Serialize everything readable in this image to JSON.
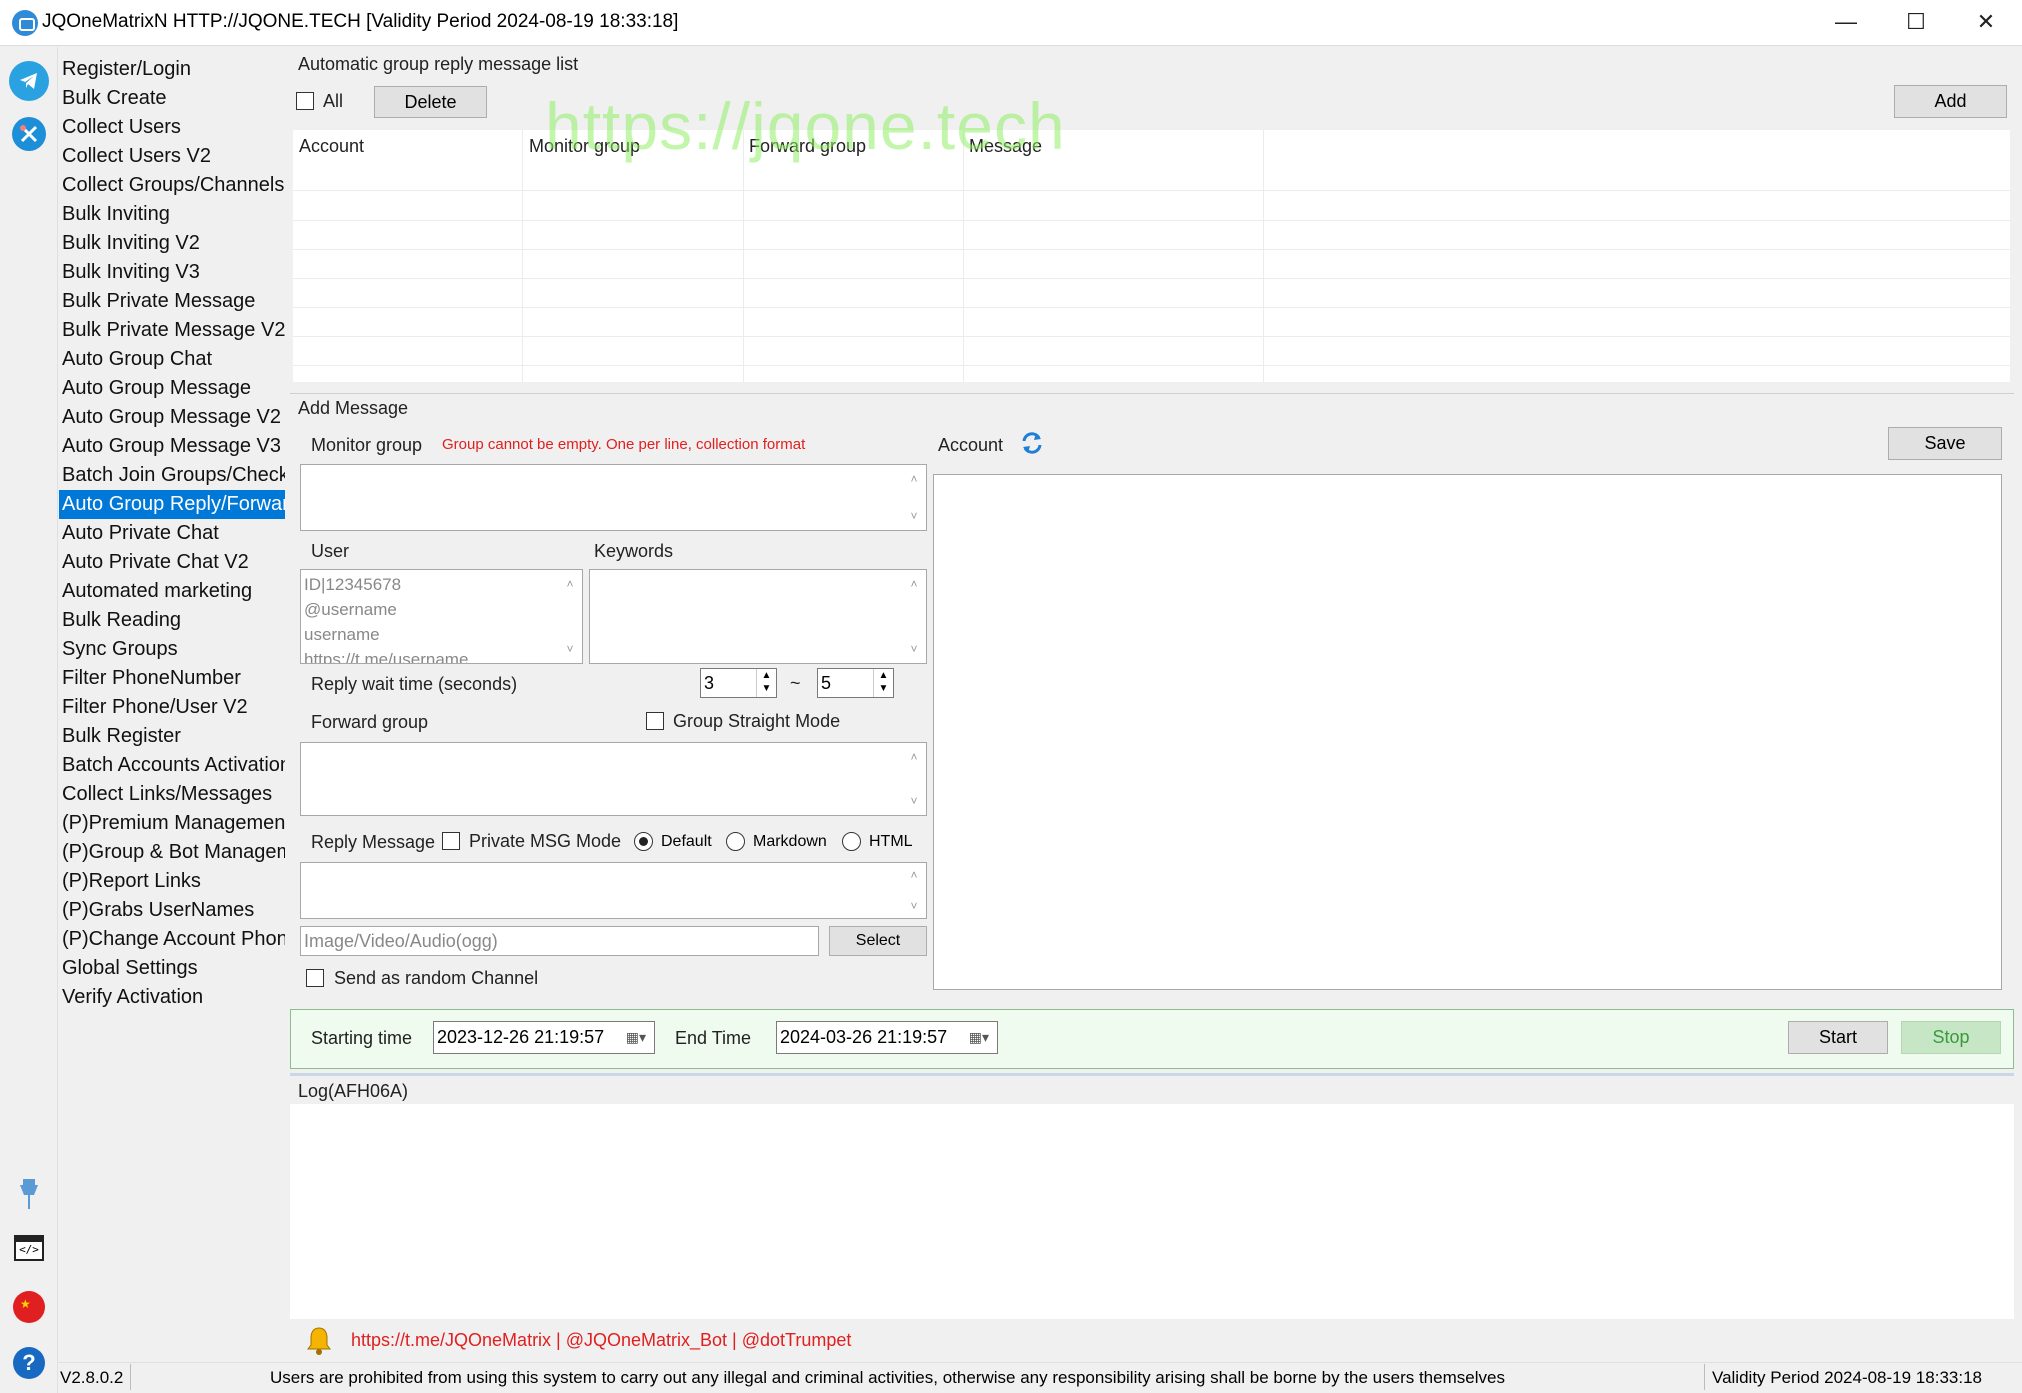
{
  "window": {
    "title": "JQOneMatrixN HTTP://JQONE.TECH  [Validity Period 2024-08-19 18:33:18]",
    "minimize": "—",
    "maximize": "☐",
    "close": "✕"
  },
  "sidebar_icons": [
    "telegram-icon",
    "tools-icon",
    "pin-icon",
    "code-window-icon",
    "china-flag-icon",
    "help-icon"
  ],
  "nav": {
    "items": [
      "Register/Login",
      "Bulk Create",
      "Collect Users",
      "Collect Users V2",
      "Collect Groups/Channels",
      "Bulk Inviting",
      "Bulk Inviting V2",
      "Bulk Inviting V3",
      "Bulk Private Message",
      "Bulk Private Message V2",
      "Auto Group Chat",
      "Auto Group Message",
      "Auto Group Message V2",
      "Auto Group Message V3",
      "Batch Join Groups/Check",
      "Auto Group Reply/Forward",
      "Auto Private Chat",
      "Auto Private Chat V2",
      "Automated marketing",
      "Bulk Reading",
      "Sync Groups",
      "Filter PhoneNumber",
      "Filter Phone/User V2",
      "Bulk Register",
      "Batch Accounts Activation",
      "Collect Links/Messages",
      "(P)Premium Management",
      "(P)Group & Bot Management",
      "(P)Report Links",
      "(P)Grabs UserNames",
      "(P)Change Account Phone",
      "Global Settings",
      "Verify Activation"
    ],
    "active_index": 15
  },
  "list_section": {
    "title": "Automatic group reply message list",
    "all_label": "All",
    "delete_label": "Delete",
    "add_label": "Add",
    "columns": [
      "Account",
      "Monitor group",
      "Forward group",
      "Message"
    ]
  },
  "watermark": "https://jqone.tech",
  "add_message": {
    "title": "Add Message",
    "monitor_group_label": "Monitor group",
    "monitor_group_hint": "Group cannot be empty. One per line, collection format",
    "account_label": "Account",
    "save_label": "Save",
    "user_label": "User",
    "keywords_label": "Keywords",
    "user_placeholder_lines": [
      "ID|12345678",
      "@username",
      "username",
      "https://t.me/username"
    ],
    "reply_wait_label": "Reply wait time (seconds)",
    "wait_min": "3",
    "wait_sep": "~",
    "wait_max": "5",
    "forward_group_label": "Forward group",
    "group_straight_label": "Group Straight Mode",
    "reply_message_label": "Reply Message",
    "private_msg_mode_label": "Private MSG Mode",
    "format_options": [
      "Default",
      "Markdown",
      "HTML"
    ],
    "format_selected": "Default",
    "media_placeholder": "Image/Video/Audio(ogg)",
    "select_label": "Select",
    "random_channel_label": "Send as random Channel"
  },
  "schedule": {
    "start_label": "Starting time",
    "start_value": "2023-12-26 21:19:57",
    "end_label": "End Time",
    "end_value": "2024-03-26 21:19:57",
    "start_button": "Start",
    "stop_button": "Stop"
  },
  "log": {
    "title": "Log(AFH06A)"
  },
  "links": {
    "text": "https://t.me/JQOneMatrix | @JQOneMatrix_Bot | @dotTrumpet"
  },
  "status_bar": {
    "version": "V2.8.0.2",
    "notice": "Users are prohibited from using this system to carry out any illegal and criminal activities, otherwise any responsibility arising shall be borne by the users themselves",
    "validity": "Validity Period 2024-08-19 18:33:18"
  },
  "colors": {
    "accent": "#0078d7",
    "hint_red": "#e02020",
    "schedule_bg": "#f0fbf0",
    "stop_bg": "#c6e6c6",
    "stop_text": "#3a9a3a",
    "link_red": "#e02020",
    "refresh_blue": "#1e7fd8"
  }
}
